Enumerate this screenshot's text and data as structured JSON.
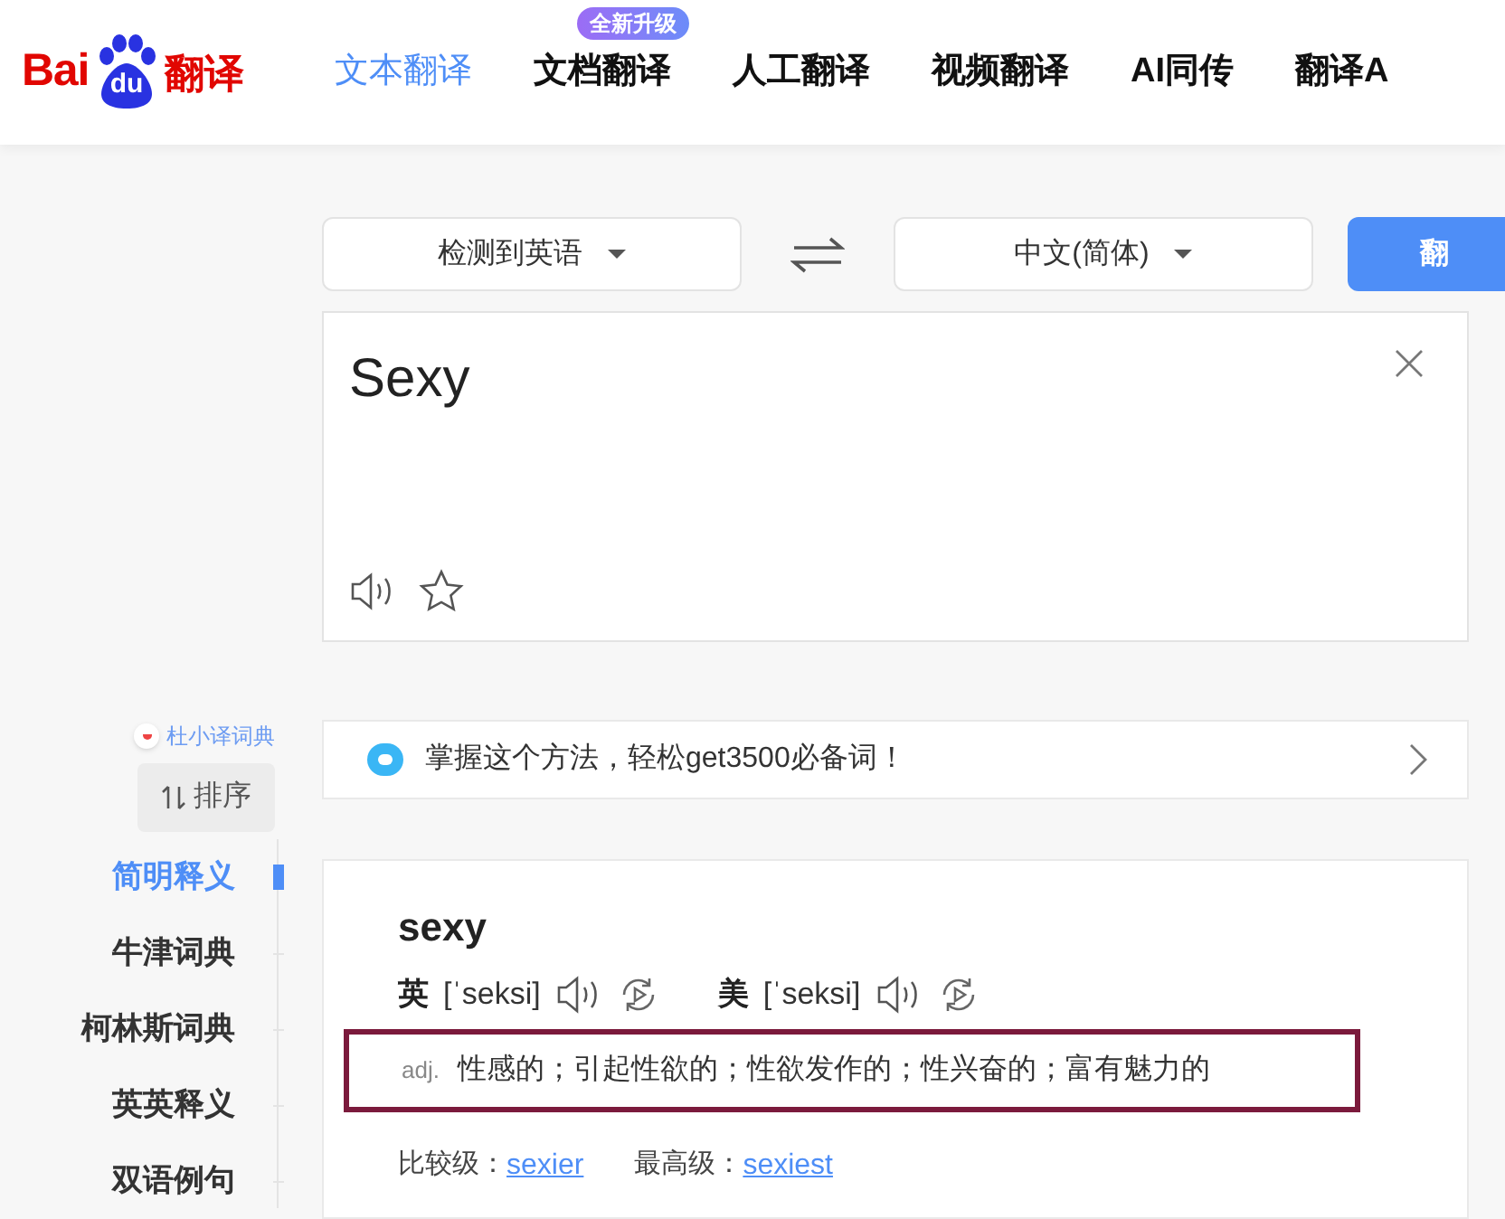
{
  "logo": {
    "part_1": "Bai",
    "part_2": "du",
    "part_3": "翻译"
  },
  "nav_tabs": [
    {
      "label": "文本翻译",
      "selected": true
    },
    {
      "label": "文档翻译",
      "selected": false,
      "badge": "全新升级"
    },
    {
      "label": "人工翻译",
      "selected": false
    },
    {
      "label": "视频翻译",
      "selected": false
    },
    {
      "label": "AI同传",
      "selected": false
    },
    {
      "label": "翻译A",
      "selected": false
    }
  ],
  "source_language": "检测到英语",
  "target_language": "中文(简体)",
  "translate_button": "翻",
  "input": {
    "value": "Sexy"
  },
  "promo_banner": "掌握这个方法，轻松get3500必备词！",
  "dictionary_sidebar": {
    "title": "杜小译词典",
    "sort_button": "排序",
    "items": [
      {
        "label": "简明释义",
        "selected": true
      },
      {
        "label": "牛津词典",
        "selected": false
      },
      {
        "label": "柯林斯词典",
        "selected": false
      },
      {
        "label": "英英释义",
        "selected": false
      },
      {
        "label": "双语例句",
        "selected": false
      }
    ]
  },
  "entry": {
    "word": "sexy",
    "pronunciations": [
      {
        "region": "英",
        "phonetic": "[ˈseksi]"
      },
      {
        "region": "美",
        "phonetic": "[ˈseksi]"
      }
    ],
    "definition": {
      "pos": "adj.",
      "meaning": "性感的；引起性欲的；性欲发作的；性兴奋的；富有魅力的",
      "highlighted": true
    },
    "forms": [
      {
        "label": "比较级：",
        "value": "sexier"
      },
      {
        "label": "最高级：",
        "value": "sexiest"
      }
    ]
  }
}
